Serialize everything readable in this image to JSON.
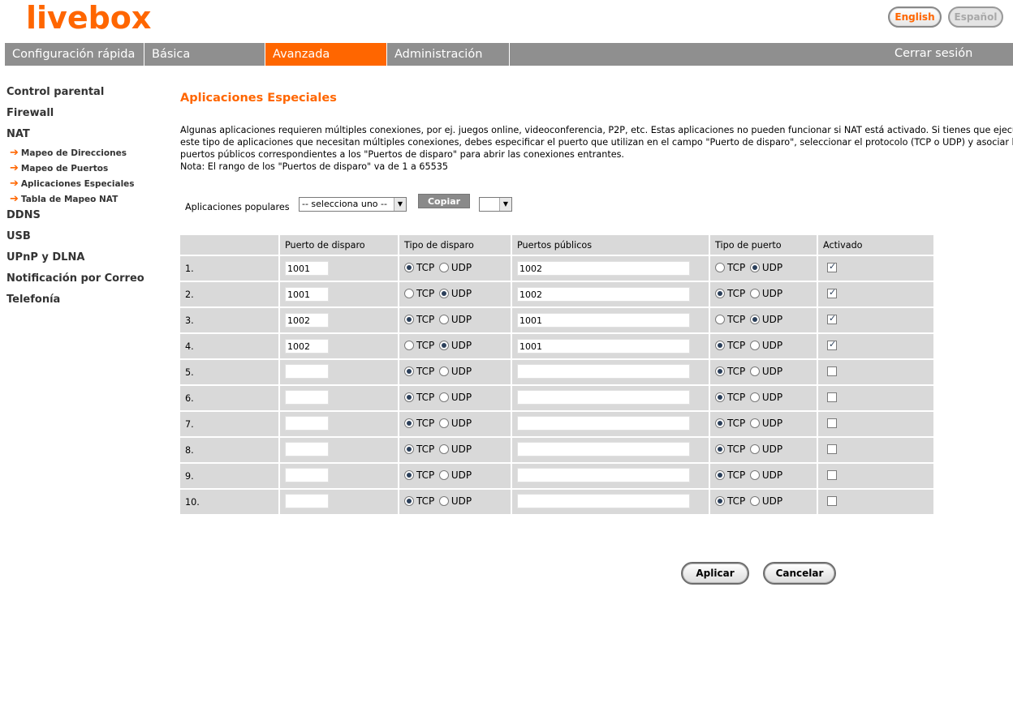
{
  "header": {
    "logo": "livebox",
    "lang_en": "English",
    "lang_es": "Español"
  },
  "nav": {
    "items": [
      "Configuración rápida",
      "Básica",
      "Avanzada",
      "Administración"
    ],
    "active": "Avanzada",
    "logout": "Cerrar sesión"
  },
  "sidebar": {
    "items": [
      "Control parental",
      "Firewall",
      "NAT"
    ],
    "nat_sub": [
      "Mapeo de Direcciones",
      "Mapeo de Puertos",
      "Aplicaciones Especiales",
      "Tabla de Mapeo NAT"
    ],
    "items2": [
      "DDNS",
      "USB",
      "UPnP y DLNA",
      "Notificación por Correo",
      "Telefonía"
    ]
  },
  "main": {
    "title": "Aplicaciones Especiales",
    "desc_lines": [
      "Algunas aplicaciones requieren múltiples conexiones, por ej. juegos online, videoconferencia, P2P, etc. Estas aplicaciones no pueden funcionar si NAT está activado. Si tienes que ejecutar",
      "este tipo de aplicaciones que necesitan múltiples conexiones, debes especificar el puerto que utilizan en el campo \"Puerto de disparo\", seleccionar el protocolo (TCP o UDP) y asociar los",
      "puertos públicos correspondientes a los \"Puertos de disparo\" para abrir las conexiones entrantes.",
      "Nota: El rango de los \"Puertos de disparo\" va de 1 a 65535"
    ],
    "popular_label": "Aplicaciones populares",
    "popular_select": "-- selecciona uno --",
    "copy_label": "Copiar",
    "copy_target": ""
  },
  "table": {
    "headers": [
      "",
      "Puerto de disparo",
      "Tipo de disparo",
      "Puertos públicos",
      "Tipo de puerto",
      "Activado"
    ],
    "tcp": "TCP",
    "udp": "UDP",
    "rows": [
      {
        "n": "1.",
        "trigger": "1001",
        "trig_type": "TCP",
        "public": "1002",
        "port_type": "UDP",
        "enabled": true
      },
      {
        "n": "2.",
        "trigger": "1001",
        "trig_type": "UDP",
        "public": "1002",
        "port_type": "TCP",
        "enabled": true
      },
      {
        "n": "3.",
        "trigger": "1002",
        "trig_type": "TCP",
        "public": "1001",
        "port_type": "UDP",
        "enabled": true
      },
      {
        "n": "4.",
        "trigger": "1002",
        "trig_type": "UDP",
        "public": "1001",
        "port_type": "TCP",
        "enabled": true
      },
      {
        "n": "5.",
        "trigger": "",
        "trig_type": "TCP",
        "public": "",
        "port_type": "TCP",
        "enabled": false
      },
      {
        "n": "6.",
        "trigger": "",
        "trig_type": "TCP",
        "public": "",
        "port_type": "TCP",
        "enabled": false
      },
      {
        "n": "7.",
        "trigger": "",
        "trig_type": "TCP",
        "public": "",
        "port_type": "TCP",
        "enabled": false
      },
      {
        "n": "8.",
        "trigger": "",
        "trig_type": "TCP",
        "public": "",
        "port_type": "TCP",
        "enabled": false
      },
      {
        "n": "9.",
        "trigger": "",
        "trig_type": "TCP",
        "public": "",
        "port_type": "TCP",
        "enabled": false
      },
      {
        "n": "10.",
        "trigger": "",
        "trig_type": "TCP",
        "public": "",
        "port_type": "TCP",
        "enabled": false
      }
    ]
  },
  "buttons": {
    "apply": "Aplicar",
    "cancel": "Cancelar"
  },
  "colors": {
    "accent": "#ff6600",
    "nav_bg": "#8f8f8f",
    "table_bg": "#d9d9d9"
  }
}
